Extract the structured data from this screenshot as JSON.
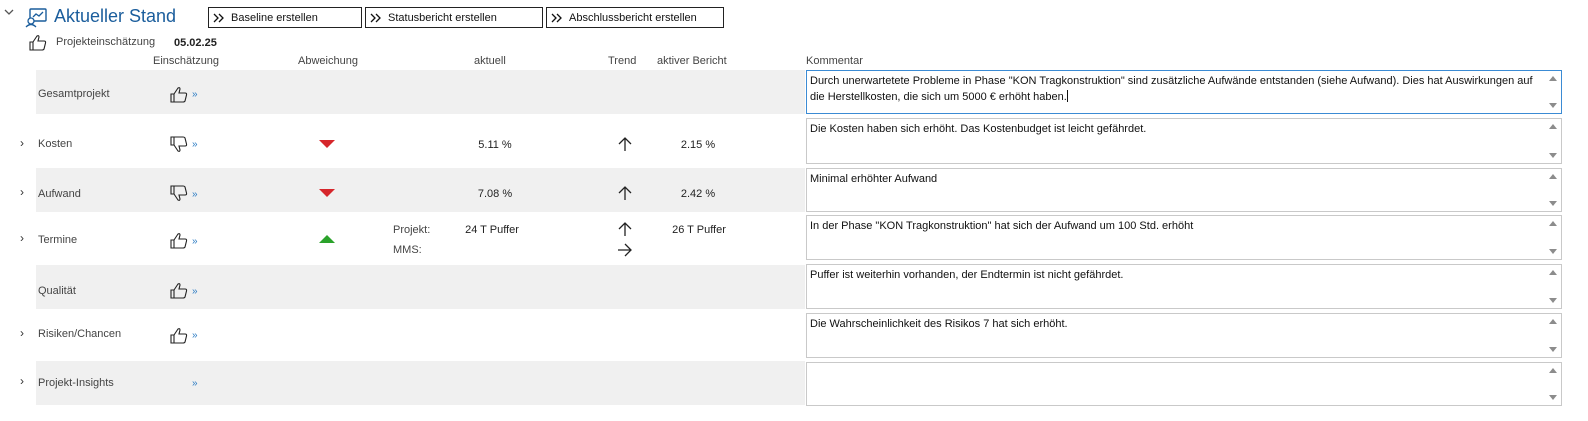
{
  "header": {
    "title": "Aktueller Stand",
    "buttons": [
      {
        "label": "Baseline erstellen"
      },
      {
        "label": "Statusbericht erstellen"
      },
      {
        "label": "Abschlussbericht erstellen"
      }
    ],
    "assessment_label": "Projekteinschätzung",
    "assessment_date": "05.02.25"
  },
  "columns": {
    "einschaetzung": "Einschätzung",
    "abweichung": "Abweichung",
    "aktuell": "aktuell",
    "trend": "Trend",
    "aktiver_bericht": "aktiver Bericht",
    "kommentar": "Kommentar"
  },
  "rows": [
    {
      "label": "Gesamtprojekt",
      "rating": "thumbs-up",
      "comment_line1": "Durch unerwartetete Probleme in Phase \"KON Tragkonstruktion\" sind zusätzliche Aufwände entstanden (siehe Aufwand). Dies hat Auswirkungen auf",
      "comment_line2": "die Herstellkosten, die sich um 5000 € erhöht haben."
    },
    {
      "label": "Kosten",
      "rating": "thumbs-down",
      "deviation": "down",
      "aktuell": "5.11 %",
      "trend": "up",
      "aktiver_bericht": "2.15 %",
      "comment": "Die Kosten haben sich erhöht. Das Kostenbudget ist leicht gefährdet."
    },
    {
      "label": "Aufwand",
      "rating": "thumbs-down",
      "deviation": "down",
      "aktuell": "7.08 %",
      "trend": "up",
      "aktiver_bericht": "2.42 %",
      "comment": "Minimal erhöhter Aufwand"
    },
    {
      "label": "Termine",
      "rating": "thumbs-up",
      "deviation": "up",
      "projekt_label": "Projekt:",
      "mms_label": "MMS:",
      "aktuell": "24 T Puffer",
      "trend": "up",
      "trend_mms": "right",
      "aktiver_bericht": "26 T Puffer",
      "comment": "In der Phase \"KON Tragkonstruktion\" hat sich der Aufwand um 100 Std. erhöht"
    },
    {
      "label": "Qualität",
      "rating": "thumbs-up",
      "comment": "Puffer ist weiterhin vorhanden, der Endtermin ist nicht gefährdet."
    },
    {
      "label": "Risiken/Chancen",
      "rating": "thumbs-up",
      "comment": "Die Wahrscheinlichkeit des Risikos 7 hat sich erhöht."
    },
    {
      "label": "Projekt-Insights",
      "comment": ""
    }
  ],
  "glyphs": {
    "chevron_right": "›",
    "chevron_down": "⌄",
    "more": "»"
  },
  "colors": {
    "title": "#1a5d9c",
    "deviation_bad": "#d6262b",
    "deviation_good": "#2aa22a",
    "link": "#2a7bc4"
  }
}
